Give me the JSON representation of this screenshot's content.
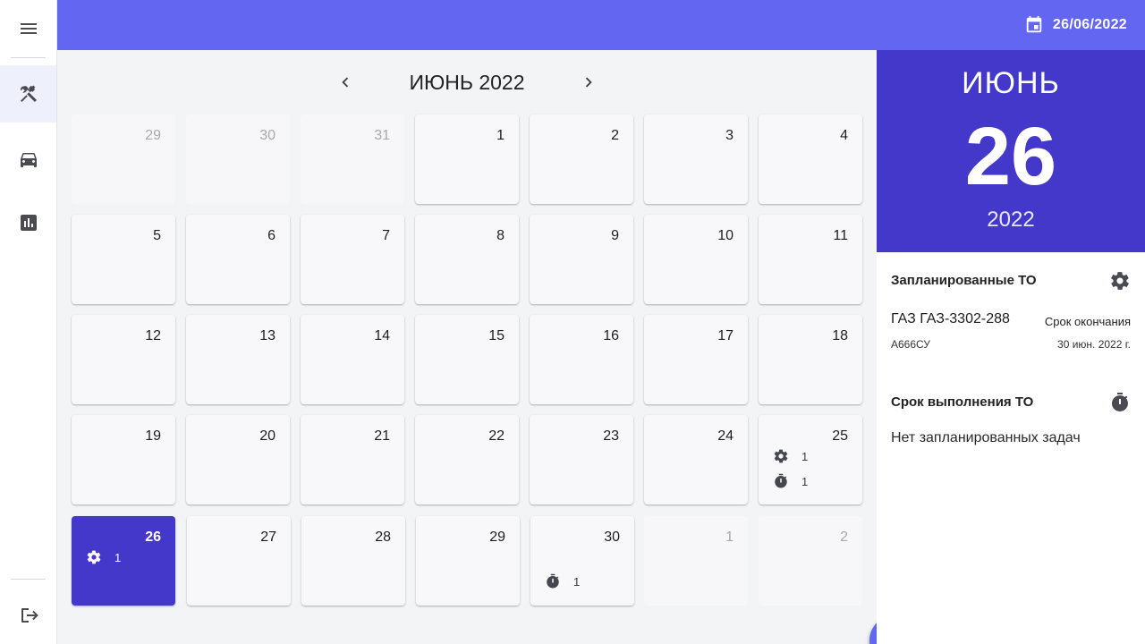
{
  "header": {
    "current_date": "26/06/2022"
  },
  "sidebar": {
    "items": [
      {
        "name": "menu-icon"
      },
      {
        "name": "tools-icon",
        "active": true
      },
      {
        "name": "car-icon"
      },
      {
        "name": "chart-icon"
      },
      {
        "name": "logout-icon"
      }
    ]
  },
  "calendar": {
    "month_title": "ИЮНЬ 2022",
    "weeks": [
      [
        {
          "day": "29",
          "muted": true
        },
        {
          "day": "30",
          "muted": true
        },
        {
          "day": "31",
          "muted": true
        },
        {
          "day": "1"
        },
        {
          "day": "2"
        },
        {
          "day": "3"
        },
        {
          "day": "4"
        }
      ],
      [
        {
          "day": "5"
        },
        {
          "day": "6"
        },
        {
          "day": "7"
        },
        {
          "day": "8"
        },
        {
          "day": "9"
        },
        {
          "day": "10"
        },
        {
          "day": "11"
        }
      ],
      [
        {
          "day": "12"
        },
        {
          "day": "13"
        },
        {
          "day": "14"
        },
        {
          "day": "15"
        },
        {
          "day": "16"
        },
        {
          "day": "17"
        },
        {
          "day": "18"
        }
      ],
      [
        {
          "day": "19"
        },
        {
          "day": "20"
        },
        {
          "day": "21"
        },
        {
          "day": "22"
        },
        {
          "day": "23"
        },
        {
          "day": "24"
        },
        {
          "day": "25",
          "events": [
            {
              "icon": "gear-icon",
              "count": "1"
            },
            {
              "icon": "timer-icon",
              "count": "1"
            }
          ]
        }
      ],
      [
        {
          "day": "26",
          "selected": true,
          "events": [
            {
              "icon": "gear-icon",
              "count": "1"
            }
          ]
        },
        {
          "day": "27"
        },
        {
          "day": "28"
        },
        {
          "day": "29"
        },
        {
          "day": "30",
          "events": [
            {
              "icon": "timer-icon",
              "count": "1"
            }
          ]
        },
        {
          "day": "1",
          "muted": true
        },
        {
          "day": "2",
          "muted": true
        }
      ]
    ],
    "selected_color": "#4338ca",
    "accent_color": "#6366f1"
  },
  "selected_date": {
    "month": "ИЮНЬ",
    "day": "26",
    "year": "2022"
  },
  "planned": {
    "title": "Запланированные ТО",
    "icon": "gear-icon",
    "vehicle_name": "ГАЗ ГАЗ-3302-288",
    "plate": "А666СУ",
    "deadline_label": "Срок окончания",
    "deadline_date": "30 июн. 2022 г."
  },
  "due": {
    "title": "Срок выполнения ТО",
    "icon": "timer-icon",
    "empty_message": "Нет запланированных задач"
  },
  "fab": {
    "icon": "plus-icon"
  }
}
